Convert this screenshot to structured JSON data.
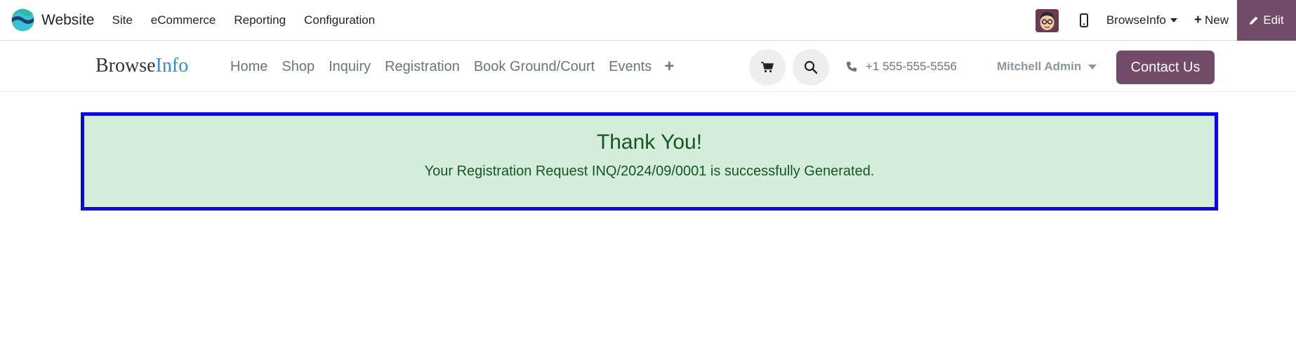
{
  "topbar": {
    "app_name": "Website",
    "menu": [
      "Site",
      "eCommerce",
      "Reporting",
      "Configuration"
    ],
    "website_switcher": "BrowseInfo",
    "new_label": "New",
    "edit_label": "Edit",
    "brand_colors": {
      "accent": "#714b67",
      "logo_teal": "#39c2d7",
      "logo_navy": "#1d3f6e"
    }
  },
  "header": {
    "logo_part1": "Browse",
    "logo_part2": "Info",
    "nav": [
      "Home",
      "Shop",
      "Inquiry",
      "Registration",
      "Book Ground/Court",
      "Events"
    ],
    "phone": "+1 555-555-5556",
    "user": "Mitchell Admin",
    "contact_label": "Contact Us",
    "icons": [
      "shopping-cart-icon",
      "search-icon",
      "phone-icon",
      "add-menu-icon"
    ]
  },
  "confirmation": {
    "title": "Thank You!",
    "message": "Your Registration Request INQ/2024/09/0001 is successfully Generated.",
    "background": "#d4edda",
    "border_color": "#0a0adc",
    "text_color": "#155724"
  }
}
